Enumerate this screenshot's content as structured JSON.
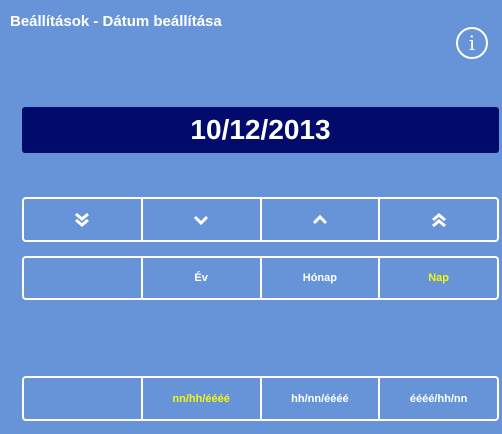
{
  "header": {
    "title": "Beállítások - Dátum beállítása",
    "info_icon_glyph": "i"
  },
  "date_display": {
    "value": "10/12/2013"
  },
  "arrow_buttons": [
    {
      "icon": "double-chevron-down-icon"
    },
    {
      "icon": "chevron-down-icon"
    },
    {
      "icon": "chevron-up-icon"
    },
    {
      "icon": "double-chevron-up-icon"
    }
  ],
  "field_buttons": [
    {
      "label": ""
    },
    {
      "label": "Év"
    },
    {
      "label": "Hónap"
    },
    {
      "label": "Nap",
      "selected": true
    }
  ],
  "format_buttons": [
    {
      "label": ""
    },
    {
      "label": "nn/hh/éééé",
      "selected": true
    },
    {
      "label": "hh/nn/éééé"
    },
    {
      "label": "éééé/hh/nn"
    }
  ],
  "colors": {
    "background": "#6794d8",
    "display_background": "#020a6b",
    "text": "#ffffff",
    "selected_text": "#f4f414"
  }
}
